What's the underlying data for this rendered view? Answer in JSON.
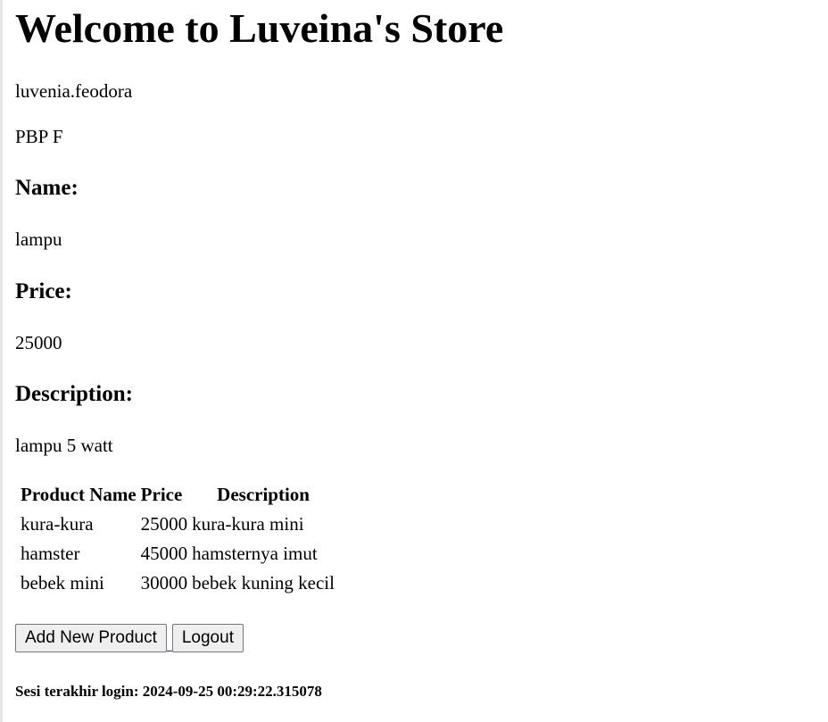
{
  "header": {
    "title": "Welcome to Luveina's Store"
  },
  "profile": {
    "username": "luvenia.feodora",
    "class": "PBP F"
  },
  "product": {
    "name_label": "Name:",
    "name": "lampu",
    "price_label": "Price:",
    "price": "25000",
    "description_label": "Description:",
    "description": "lampu 5 watt"
  },
  "table": {
    "headers": [
      "Product Name",
      "Price",
      "Description"
    ],
    "rows": [
      [
        "kura-kura",
        "25000",
        "kura-kura mini"
      ],
      [
        "hamster",
        "45000",
        "hamsternya imut"
      ],
      [
        "bebek mini",
        "30000",
        "bebek kuning kecil"
      ]
    ]
  },
  "actions": {
    "add_label": "Add New Product",
    "logout_label": "Logout"
  },
  "footer": {
    "last_login": "Sesi terakhir login: 2024-09-25 00:29:22.315078"
  }
}
